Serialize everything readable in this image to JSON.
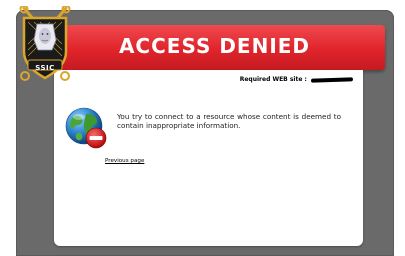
{
  "banner": {
    "title": "ACCESS DENIED"
  },
  "logo": {
    "text": "SSIC"
  },
  "content": {
    "required_label": "Required WEB site :",
    "message": "You try to connect to a resource whose content is deemed to contain inappropriate information.",
    "previous_link": "Previous page"
  },
  "colors": {
    "banner_red": "#e0242b",
    "frame_gray": "#6a6a6a",
    "logo_gold": "#d9a52a"
  },
  "icons": {
    "globe": "globe-forbidden-icon",
    "logo": "ssic-crest-logo"
  }
}
